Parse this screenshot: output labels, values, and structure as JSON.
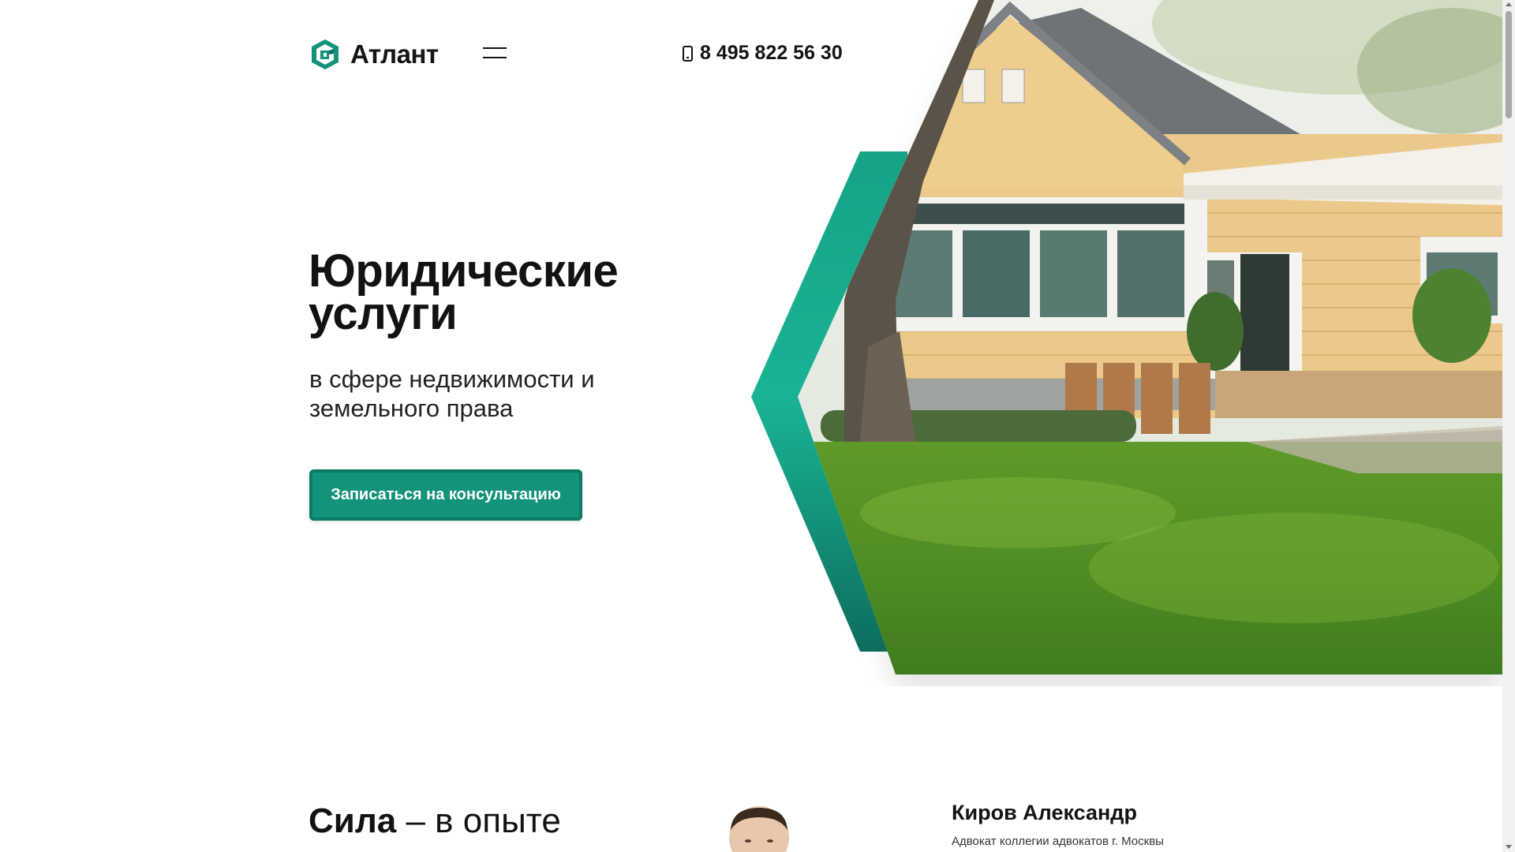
{
  "header": {
    "logo_text": "Атлант",
    "phone": "8 495 822 56 30",
    "brand_color": "#12937a"
  },
  "hero": {
    "title_line1": "Юридические",
    "title_line2": "услуги",
    "subtitle_line1": "в сфере недвижимости и",
    "subtitle_line2": "земельного права",
    "cta_label": "Записаться на консультацию"
  },
  "about": {
    "title_bold": "Сила",
    "title_rest": "– в опыте",
    "person_name": "Киров Александр",
    "person_role": "Адвокат коллегии адвокатов г. Москвы"
  },
  "icons": [
    "logo-icon",
    "menu-icon",
    "phone-icon"
  ]
}
